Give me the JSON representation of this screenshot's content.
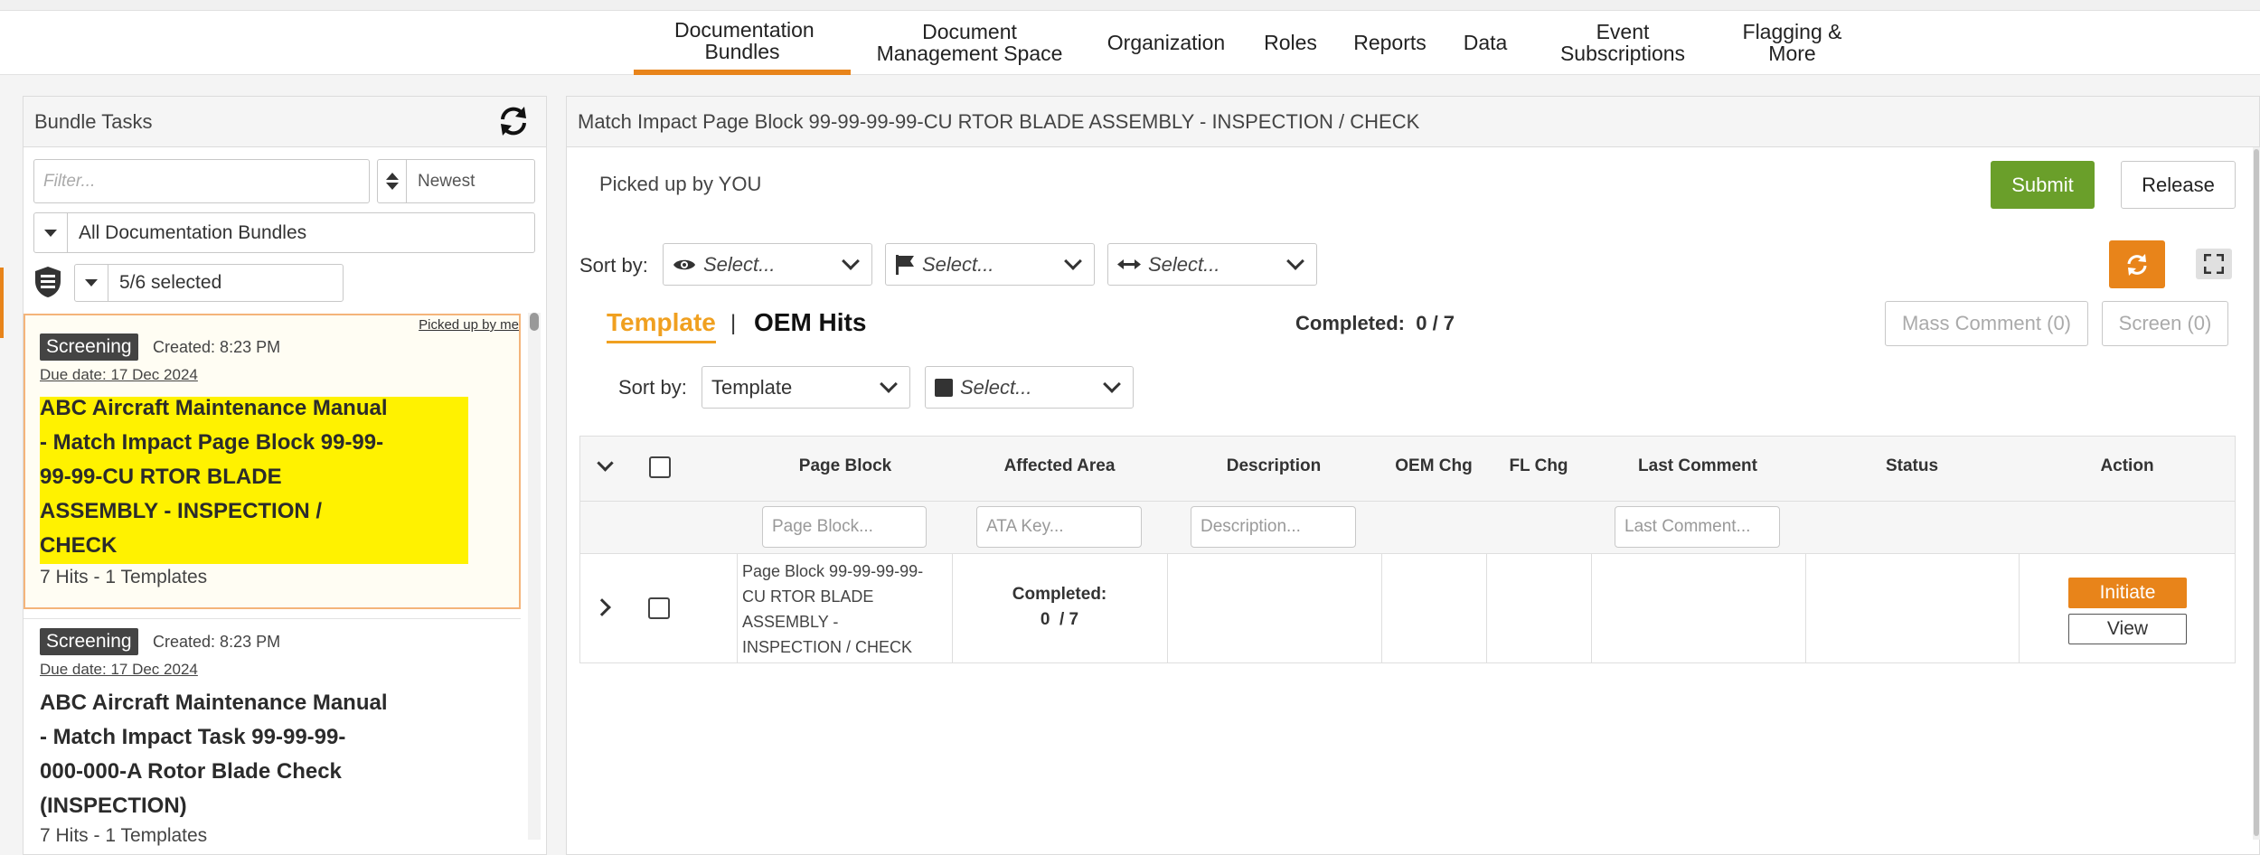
{
  "nav": {
    "items": [
      {
        "label": "Documentation Bundles",
        "active": true
      },
      {
        "label": "Document Management Space"
      },
      {
        "label": "Organization"
      },
      {
        "label": "Roles"
      },
      {
        "label": "Reports"
      },
      {
        "label": "Data"
      },
      {
        "label": "Event Subscriptions"
      },
      {
        "label": "Flagging & More"
      }
    ]
  },
  "left": {
    "title": "Bundle Tasks",
    "filter_placeholder": "Filter...",
    "sort_value": "Newest",
    "bundle_value": "All Documentation Bundles",
    "selected_value": "5/6 selected",
    "tasks": [
      {
        "picked_up": "Picked up by me",
        "badge": "Screening",
        "created": "Created: 8:23 PM",
        "due": "Due date: 17 Dec 2024",
        "title_lines": [
          "ABC Aircraft Maintenance Manual",
          "- Match Impact Page Block 99-99-",
          "99-99-CU RTOR BLADE",
          "ASSEMBLY - INSPECTION /",
          "CHECK"
        ],
        "hits": "7 Hits - 1 Templates"
      },
      {
        "badge": "Screening",
        "created": "Created: 8:23 PM",
        "due": "Due date: 17 Dec 2024",
        "title_lines": [
          "ABC Aircraft Maintenance Manual",
          "- Match Impact Task 99-99-99-",
          "000-000-A Rotor Blade Check",
          "(INSPECTION)"
        ],
        "hits": "7 Hits - 1 Templates"
      }
    ]
  },
  "main": {
    "title": "Match Impact Page Block 99-99-99-99-CU RTOR BLADE ASSEMBLY - INSPECTION / CHECK",
    "picked_up": "Picked up by YOU",
    "submit": "Submit",
    "release": "Release",
    "sort_label": "Sort by:",
    "sort1": "Select...",
    "sort2": "Select...",
    "sort3": "Select...",
    "tab_template": "Template",
    "tab_sep": "|",
    "tab_oem": "OEM Hits",
    "completed": "Completed:  0 / 7",
    "mass_comment": "Mass Comment (0)",
    "screen": "Screen (0)",
    "sort_label2": "Sort by:",
    "sort_template": "Template",
    "sort_select": "Select...",
    "columns": [
      "Page Block",
      "Affected Area",
      "Description",
      "OEM Chg",
      "FL Chg",
      "Last Comment",
      "Status",
      "Action"
    ],
    "filters": {
      "page_block": "Page Block...",
      "ata_key": "ATA Key...",
      "description": "Description...",
      "last_comment": "Last Comment..."
    },
    "row": {
      "page_block_lines": [
        "Page Block 99-99-99-99-",
        "CU RTOR BLADE",
        "ASSEMBLY -",
        "INSPECTION / CHECK"
      ],
      "affected_line1": "Completed:",
      "affected_line2": "0  / 7",
      "initiate": "Initiate",
      "view": "View"
    }
  },
  "colors": {
    "accent": "#e8841a",
    "submit": "#6a9f2a",
    "highlight": "#fff200"
  }
}
